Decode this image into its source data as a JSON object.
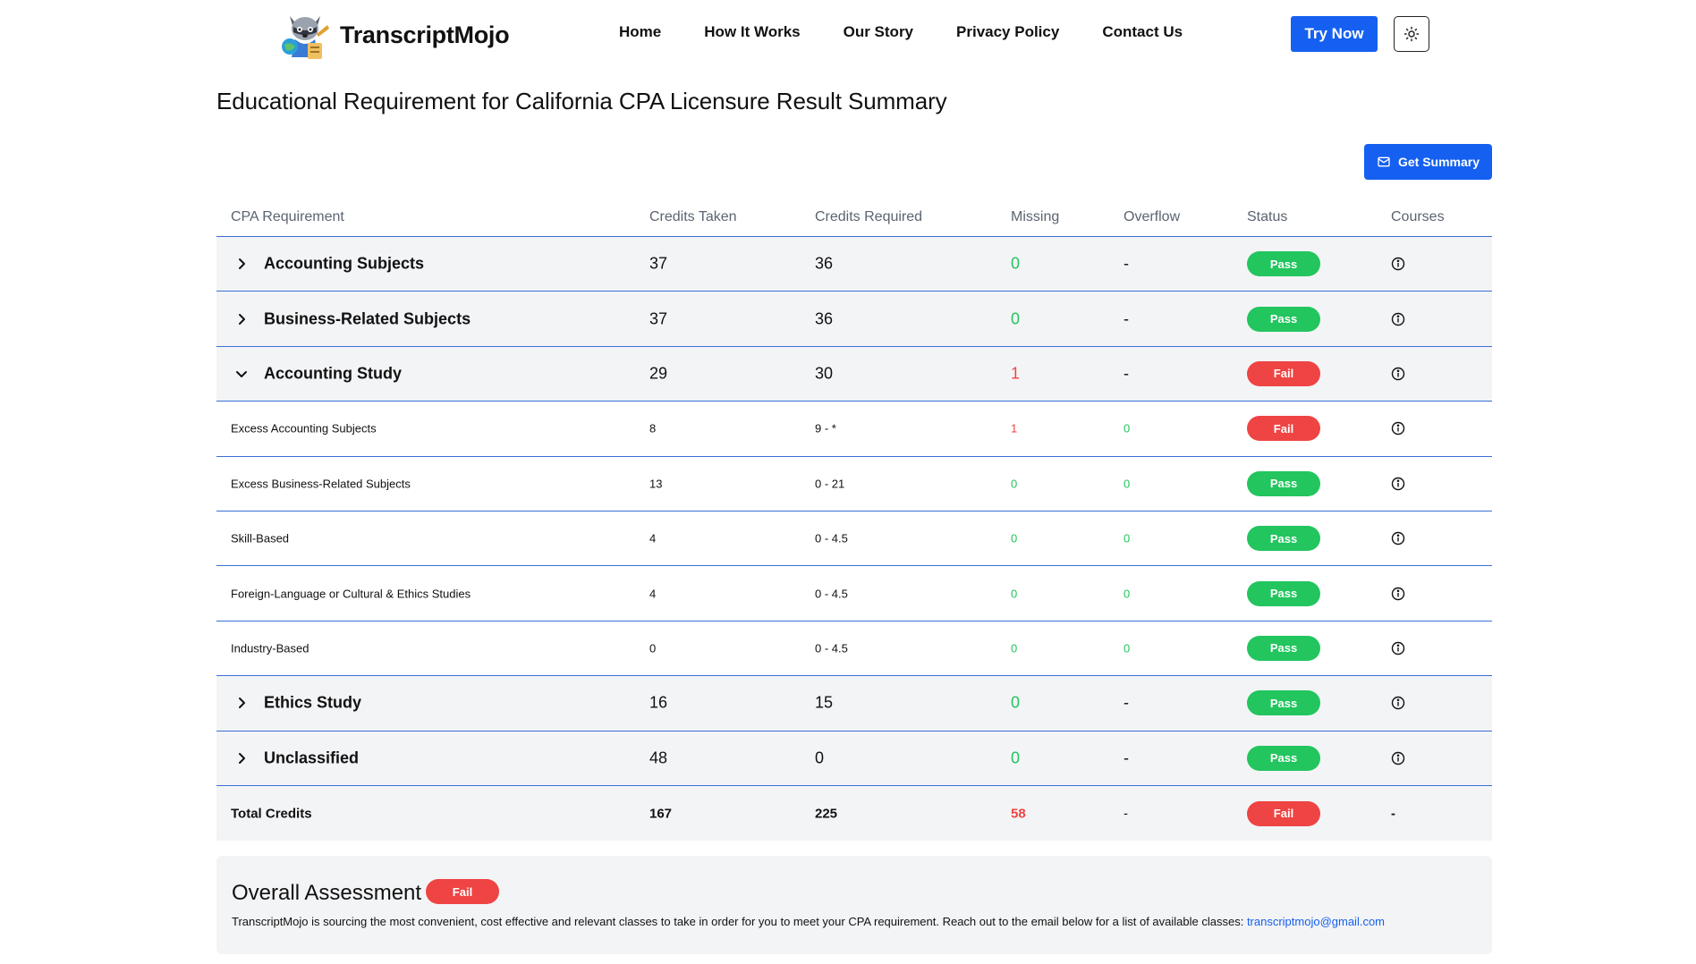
{
  "nav": {
    "brand": "TranscriptMojo",
    "links": [
      "Home",
      "How It Works",
      "Our Story",
      "Privacy Policy",
      "Contact Us"
    ],
    "try_now": "Try Now"
  },
  "page": {
    "title": "Educational Requirement for California CPA Licensure Result Summary",
    "get_summary": "Get Summary"
  },
  "table": {
    "headers": [
      "CPA Requirement",
      "Credits Taken",
      "Credits Required",
      "Missing",
      "Overflow",
      "Status",
      "Courses"
    ],
    "rows": [
      {
        "name": "Accounting Subjects",
        "taken": "37",
        "required": "36",
        "missing": "0",
        "overflow": "-",
        "status": "Pass"
      },
      {
        "name": "Business-Related Subjects",
        "taken": "37",
        "required": "36",
        "missing": "0",
        "overflow": "-",
        "status": "Pass"
      },
      {
        "name": "Accounting Study",
        "taken": "29",
        "required": "30",
        "missing": "1",
        "overflow": "-",
        "status": "Fail"
      },
      {
        "name": "Excess Accounting Subjects",
        "taken": "8",
        "required": "9 - *",
        "missing": "1",
        "overflow": "0",
        "status": "Fail"
      },
      {
        "name": "Excess Business-Related Subjects",
        "taken": "13",
        "required": "0 - 21",
        "missing": "0",
        "overflow": "0",
        "status": "Pass"
      },
      {
        "name": "Skill-Based",
        "taken": "4",
        "required": "0 - 4.5",
        "missing": "0",
        "overflow": "0",
        "status": "Pass"
      },
      {
        "name": "Foreign-Language or Cultural & Ethics Studies",
        "taken": "4",
        "required": "0 - 4.5",
        "missing": "0",
        "overflow": "0",
        "status": "Pass"
      },
      {
        "name": "Industry-Based",
        "taken": "0",
        "required": "0 - 4.5",
        "missing": "0",
        "overflow": "0",
        "status": "Pass"
      },
      {
        "name": "Ethics Study",
        "taken": "16",
        "required": "15",
        "missing": "0",
        "overflow": "-",
        "status": "Pass"
      },
      {
        "name": "Unclassified",
        "taken": "48",
        "required": "0",
        "missing": "0",
        "overflow": "-",
        "status": "Pass"
      }
    ],
    "total": {
      "name": "Total Credits",
      "taken": "167",
      "required": "225",
      "missing": "58",
      "overflow": "-",
      "status": "Fail",
      "courses": "-"
    }
  },
  "overall": {
    "title": "Overall Assessment",
    "status": "Fail",
    "text": "TranscriptMojo is sourcing the most convenient, cost effective and relevant classes to take in order for you to meet your CPA requirement. Reach out to the email below for a list of available classes: ",
    "email": "transcriptmojo@gmail.com"
  },
  "colors": {
    "accent": "#1560f0",
    "pass": "#22c55e",
    "fail": "#ef4444",
    "row_bg": "#f3f4f6",
    "divider": "#3b6fd6"
  },
  "icons": {
    "theme": "sun-icon",
    "summary": "mail-icon",
    "expand": "chevron-right-icon",
    "collapse": "chevron-down-icon",
    "courses": "info-icon"
  }
}
